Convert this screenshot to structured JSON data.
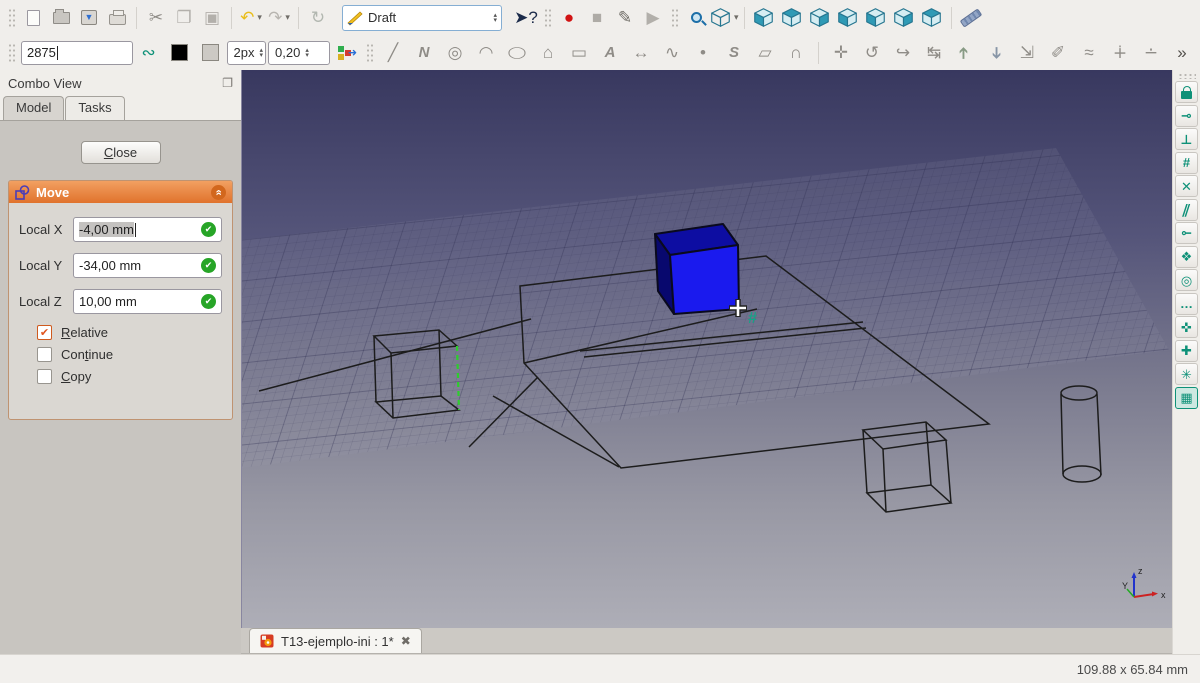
{
  "colors": {
    "accent_orange": "#e0722c",
    "teal": "#0e9178",
    "cube_front": "#1a1aee",
    "cube_top": "#0d0da2",
    "cube_left": "#08086e",
    "wire": "#1c1c1c",
    "green_edge": "#2ecc2e"
  },
  "toolbar_main": {
    "file_items": [
      {
        "handle": true
      },
      {
        "name": "new-document-button",
        "css": "ic-page"
      },
      {
        "name": "open-document-button",
        "css": "ic-folder"
      },
      {
        "name": "save-document-button",
        "css": "ic-save"
      },
      {
        "name": "print-document-button",
        "css": "ic-print"
      },
      {
        "sep": true
      },
      {
        "name": "cut-button",
        "glyph": "✂",
        "color": "#8e8b86"
      },
      {
        "name": "copy-button",
        "glyph": "❐",
        "color": "#b3b0ab"
      },
      {
        "name": "paste-button",
        "glyph": "▣",
        "color": "#b3b0ab"
      },
      {
        "sep": true
      },
      {
        "name": "undo-button",
        "glyph": "↶",
        "color": "#e9bd1b",
        "caret": true
      },
      {
        "name": "redo-button",
        "glyph": "↷",
        "color": "#b8b5b0",
        "caret": true
      },
      {
        "sep": true
      },
      {
        "name": "refresh-button",
        "glyph": "↻",
        "color": "#b2b7b0"
      }
    ],
    "workbench_selector": {
      "value": "Draft"
    },
    "right_items": [
      {
        "name": "whats-this-button",
        "glyph": "➤?",
        "color": "#1b2b4a"
      },
      {
        "handle": true
      },
      {
        "name": "macro-record-button",
        "glyph": "●",
        "color": "#d11313"
      },
      {
        "name": "macro-stop-button",
        "glyph": "■",
        "color": "#aeaba6"
      },
      {
        "name": "macro-edit-button",
        "glyph": "✎",
        "color": "#6f6c66"
      },
      {
        "name": "macro-play-button",
        "glyph": "▶",
        "color": "#b2afaa"
      },
      {
        "handle": true
      },
      {
        "name": "view-fit-all-button",
        "css": "ic-zoom"
      },
      {
        "name": "view-axonometric-button",
        "cube": "wire",
        "caret": true
      },
      {
        "sep": true
      },
      {
        "name": "view-front-button",
        "cube": "front"
      },
      {
        "name": "view-top-button",
        "cube": "top"
      },
      {
        "name": "view-right-button",
        "cube": "right"
      },
      {
        "name": "view-rear-button",
        "cube": "left"
      },
      {
        "name": "view-bottom-button",
        "cube": "front"
      },
      {
        "name": "view-left-button",
        "cube": "right"
      },
      {
        "name": "view-isometric-button",
        "cube": "top"
      },
      {
        "sep": true
      },
      {
        "name": "measure-distance-button",
        "css": "ic-ruler"
      }
    ]
  },
  "toolbar_draft": {
    "command_input": {
      "value": "2875"
    },
    "style_items": [
      {
        "name": "construction-mode-button",
        "glyph": "∾",
        "color": "#0e9178"
      },
      {
        "name": "line-color-swatch",
        "css": "sw sw-black"
      },
      {
        "name": "face-color-swatch",
        "css": "sw sw-gray"
      }
    ],
    "line_width": {
      "value": "2px"
    },
    "text_scale": {
      "value": "0,20"
    },
    "apply_style_name": "apply-style-button",
    "tool_items": [
      {
        "name": "draft-line-tool",
        "glyph": "╱"
      },
      {
        "name": "draft-wire-tool",
        "glyph": "N",
        "cls": "ital"
      },
      {
        "name": "draft-circle-tool",
        "glyph": "◎"
      },
      {
        "name": "draft-arc-tool",
        "glyph": "◠"
      },
      {
        "name": "draft-ellipse-tool",
        "glyph": "◯",
        "cls": "squash"
      },
      {
        "name": "draft-polygon-tool",
        "glyph": "⌂"
      },
      {
        "name": "draft-rectangle-tool",
        "glyph": "▭"
      },
      {
        "name": "draft-text-tool",
        "glyph": "A",
        "cls": "ital"
      },
      {
        "name": "draft-dimension-tool",
        "glyph": "↔"
      },
      {
        "name": "draft-bspline-tool",
        "glyph": "∿"
      },
      {
        "name": "draft-point-tool",
        "glyph": "•"
      },
      {
        "name": "draft-shapestring-tool",
        "glyph": "S",
        "cls": "ital"
      },
      {
        "name": "draft-facebinder-tool",
        "glyph": "▱"
      },
      {
        "name": "draft-bezier-tool",
        "glyph": "∩"
      },
      {
        "sep": true
      },
      {
        "name": "draft-move-tool",
        "glyph": "✛"
      },
      {
        "name": "draft-rotate-tool",
        "glyph": "↺"
      },
      {
        "name": "draft-offset-tool",
        "glyph": "↪"
      },
      {
        "name": "draft-trimex-tool",
        "glyph": "↹"
      },
      {
        "name": "draft-upgrade-tool",
        "glyph": "➔",
        "cls": "rotup",
        "color": "#879a84"
      },
      {
        "name": "draft-downgrade-tool",
        "glyph": "➔",
        "cls": "rotdn",
        "color": "#8795a6"
      },
      {
        "name": "draft-scale-tool",
        "glyph": "⇲"
      },
      {
        "name": "draft-edit-tool",
        "glyph": "✐"
      },
      {
        "name": "draft-wire-to-bspline-tool",
        "glyph": "≈"
      },
      {
        "name": "draft-add-point-tool",
        "glyph": "∔"
      },
      {
        "name": "draft-remove-point-tool",
        "glyph": "∸"
      },
      {
        "name": "toolbar-overflow-button",
        "glyph": "»",
        "color": "#55524e"
      }
    ]
  },
  "combo_view": {
    "title": "Combo View",
    "tabs": [
      {
        "label": "Model",
        "active": false
      },
      {
        "label": "Tasks",
        "active": true
      }
    ],
    "close_label": "Close",
    "close_mn": "C",
    "move_task": {
      "title": "Move",
      "fields": [
        {
          "label": "Local X",
          "value": "-4,00 mm",
          "selected": true
        },
        {
          "label": "Local Y",
          "value": "-34,00 mm",
          "selected": false
        },
        {
          "label": "Local Z",
          "value": "10,00 mm",
          "selected": false
        }
      ],
      "checkboxes": [
        {
          "label": "Relative",
          "mn": "R",
          "checked": true
        },
        {
          "label": "Continue",
          "mn": "t",
          "checked": false
        },
        {
          "label": "Copy",
          "mn": "C",
          "checked": false
        }
      ]
    }
  },
  "snap_toolbar": {
    "items": [
      {
        "name": "snap-lock-button",
        "css": "css-lock"
      },
      {
        "name": "snap-midpoint-button",
        "glyph": "⊸"
      },
      {
        "name": "snap-perpendicular-button",
        "glyph": "⊥"
      },
      {
        "name": "snap-grid-button",
        "glyph": "#"
      },
      {
        "name": "snap-intersection-button",
        "glyph": "✕"
      },
      {
        "name": "snap-parallel-button",
        "glyph": "∥",
        "cls": "slant"
      },
      {
        "name": "snap-endpoint-button",
        "glyph": "⊸",
        "cls": "rot180"
      },
      {
        "name": "snap-angle-button",
        "glyph": "❖"
      },
      {
        "name": "snap-center-button",
        "glyph": "◎"
      },
      {
        "name": "snap-extension-button",
        "glyph": "…"
      },
      {
        "name": "snap-near-button",
        "glyph": "✜"
      },
      {
        "name": "snap-ortho-button",
        "glyph": "✚"
      },
      {
        "name": "snap-special-button",
        "glyph": "✳"
      },
      {
        "name": "toggle-grid-button",
        "glyph": "▦",
        "cls": "active"
      }
    ]
  },
  "mdi": {
    "tab_label": "T13-ejemplo-ini : 1*",
    "tab_close": "✖"
  },
  "status_bar": {
    "coordinates": "109.88 x 65.84 mm"
  },
  "viewport": {
    "axis_x": "x",
    "axis_y": "Y",
    "axis_z": "z"
  }
}
